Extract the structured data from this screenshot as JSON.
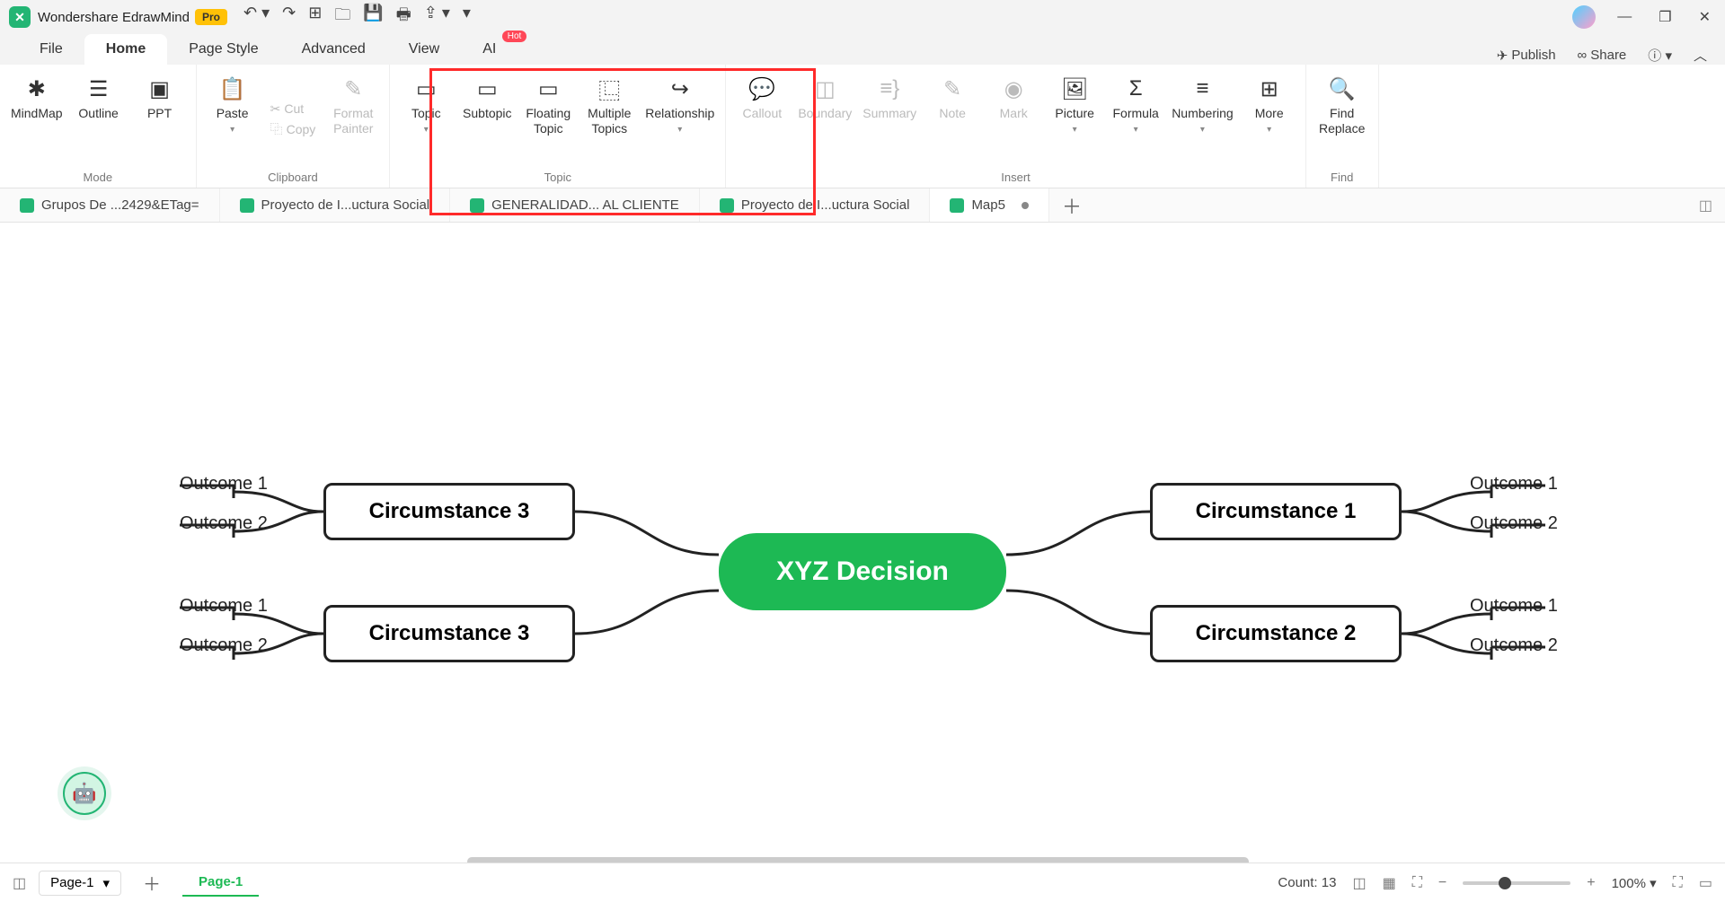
{
  "app": {
    "name": "Wondershare EdrawMind",
    "badge": "Pro"
  },
  "window": {
    "min": "—",
    "max": "❐",
    "close": "✕"
  },
  "menu": {
    "tabs": [
      "File",
      "Home",
      "Page Style",
      "Advanced",
      "View",
      "AI"
    ],
    "active": "Home",
    "hot": "Hot",
    "publish": "Publish",
    "share": "Share"
  },
  "ribbon": {
    "mode": {
      "label": "Mode",
      "mindmap": "MindMap",
      "outline": "Outline",
      "ppt": "PPT"
    },
    "clipboard": {
      "label": "Clipboard",
      "paste": "Paste",
      "cut": "Cut",
      "copy": "Copy",
      "format_painter": "Format\nPainter"
    },
    "topic": {
      "label": "Topic",
      "topic": "Topic",
      "subtopic": "Subtopic",
      "floating_topic": "Floating\nTopic",
      "multiple_topics": "Multiple\nTopics",
      "relationship": "Relationship"
    },
    "insert": {
      "label": "Insert",
      "callout": "Callout",
      "boundary": "Boundary",
      "summary": "Summary",
      "note": "Note",
      "mark": "Mark",
      "picture": "Picture",
      "formula": "Formula",
      "numbering": "Numbering",
      "more": "More"
    },
    "find": {
      "label": "Find",
      "find_replace": "Find\nReplace"
    }
  },
  "doctabs": {
    "tabs": [
      {
        "label": "Grupos De ...2429&ETag="
      },
      {
        "label": "Proyecto de I...uctura Social"
      },
      {
        "label": "GENERALIDAD... AL CLIENTE"
      },
      {
        "label": "Proyecto de I...uctura Social"
      },
      {
        "label": "Map5",
        "active": true,
        "dirty": true
      }
    ]
  },
  "mindmap": {
    "central": "XYZ Decision",
    "left": [
      {
        "title": "Circumstance 3",
        "outcomes": [
          "Outcome 1",
          "Outcome 2"
        ]
      },
      {
        "title": "Circumstance 3",
        "outcomes": [
          "Outcome 1",
          "Outcome 2"
        ]
      }
    ],
    "right": [
      {
        "title": "Circumstance 1",
        "outcomes": [
          "Outcome 1",
          "Outcome 2"
        ]
      },
      {
        "title": "Circumstance 2",
        "outcomes": [
          "Outcome 1",
          "Outcome 2"
        ]
      }
    ]
  },
  "status": {
    "page_sel": "Page-1",
    "page_tab": "Page-1",
    "count": "Count: 13",
    "zoom": "100%"
  }
}
